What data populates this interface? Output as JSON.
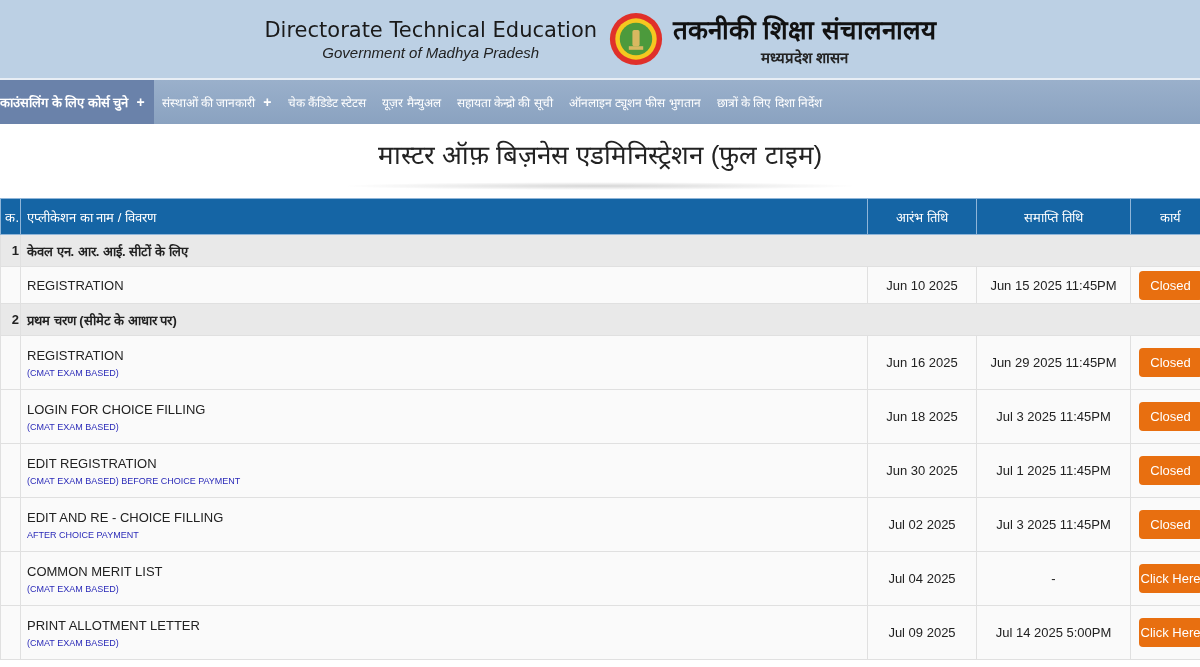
{
  "header": {
    "title_en": "Directorate Technical Education",
    "subtitle_en": "Government of Madhya Pradesh",
    "title_hi": "तकनीकी शिक्षा संचालनालय",
    "subtitle_hi": "मध्यप्रदेश शासन"
  },
  "nav": [
    {
      "label": "काउंसलिंग के लिए कोर्स चुने",
      "mark": "+",
      "selected": true
    },
    {
      "label": "संस्थाओं की जानकारी",
      "mark": "+",
      "selected": false
    },
    {
      "label": "चेक कैंडिडेट स्टेटस",
      "selected": false
    },
    {
      "label": "यूज़र मैन्युअल",
      "selected": false
    },
    {
      "label": "सहायता केन्द्रो की सूची",
      "selected": false
    },
    {
      "label": "ऑनलाइन ट्यूशन फीस भुगतान",
      "selected": false
    },
    {
      "label": "छात्रों के लिए दिशा निर्देश",
      "selected": false
    }
  ],
  "page_title": "मास्टर ऑफ़ बिज़नेस एडमिनिस्ट्रेशन (फुल टाइम)",
  "table": {
    "columns": [
      "क.",
      "एप्लीकेशन का नाम / विवरण",
      "आरंभ तिथि",
      "समाप्ति तिथि",
      "कार्य"
    ],
    "groups": [
      {
        "number": "1",
        "title": "केवल एन. आर. आई. सीटों के लिए",
        "rows": [
          {
            "name": "REGISTRATION",
            "start": "Jun 10 2025",
            "end": "Jun 15 2025 11:45PM",
            "action": "Closed"
          }
        ]
      },
      {
        "number": "2",
        "title": "प्रथम चरण (सीमेट के आधार पर)",
        "rows": [
          {
            "name": "REGISTRATION",
            "note": "(CMAT EXAM BASED)",
            "start": "Jun 16 2025",
            "end": "Jun 29 2025 11:45PM",
            "action": "Closed"
          },
          {
            "name": "LOGIN FOR CHOICE FILLING",
            "note": "(CMAT EXAM BASED)",
            "start": "Jun 18 2025",
            "end": "Jul 3 2025 11:45PM",
            "action": "Closed"
          },
          {
            "name": "EDIT REGISTRATION",
            "note": "(CMAT EXAM BASED) BEFORE CHOICE PAYMENT",
            "start": "Jun 30 2025",
            "end": "Jul 1 2025 11:45PM",
            "action": "Closed"
          },
          {
            "name": "EDIT AND RE - CHOICE FILLING",
            "note": "AFTER CHOICE PAYMENT",
            "start": "Jul 02 2025",
            "end": "Jul 3 2025 11:45PM",
            "action": "Closed"
          },
          {
            "name": "COMMON MERIT LIST",
            "note": "(CMAT EXAM BASED)",
            "start": "Jul 04 2025",
            "end": "-",
            "action": "Click Here"
          },
          {
            "name": "PRINT ALLOTMENT LETTER",
            "note": "(CMAT EXAM BASED)",
            "start": "Jul 09 2025",
            "end": "Jul 14 2025 5:00PM",
            "action": "Click Here"
          }
        ]
      }
    ]
  }
}
